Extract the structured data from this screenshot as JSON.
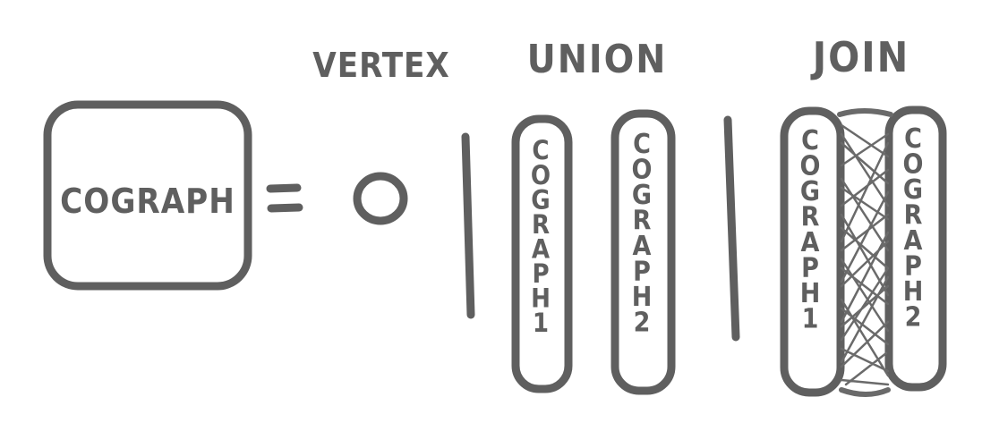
{
  "colors": {
    "ink": "#5f5f5f",
    "background": "#ffffff"
  },
  "headers": {
    "vertex": "VERTEX",
    "union": "UNION",
    "join": "JOIN"
  },
  "main_box": {
    "label": "COGRAPH"
  },
  "equals": "=",
  "vertex_symbol": "O",
  "union_parts": [
    {
      "label": "COGRAPH1"
    },
    {
      "label": "COGRAPH2"
    }
  ],
  "join_parts": [
    {
      "label": "COGRAPH1"
    },
    {
      "label": "COGRAPH2"
    }
  ]
}
